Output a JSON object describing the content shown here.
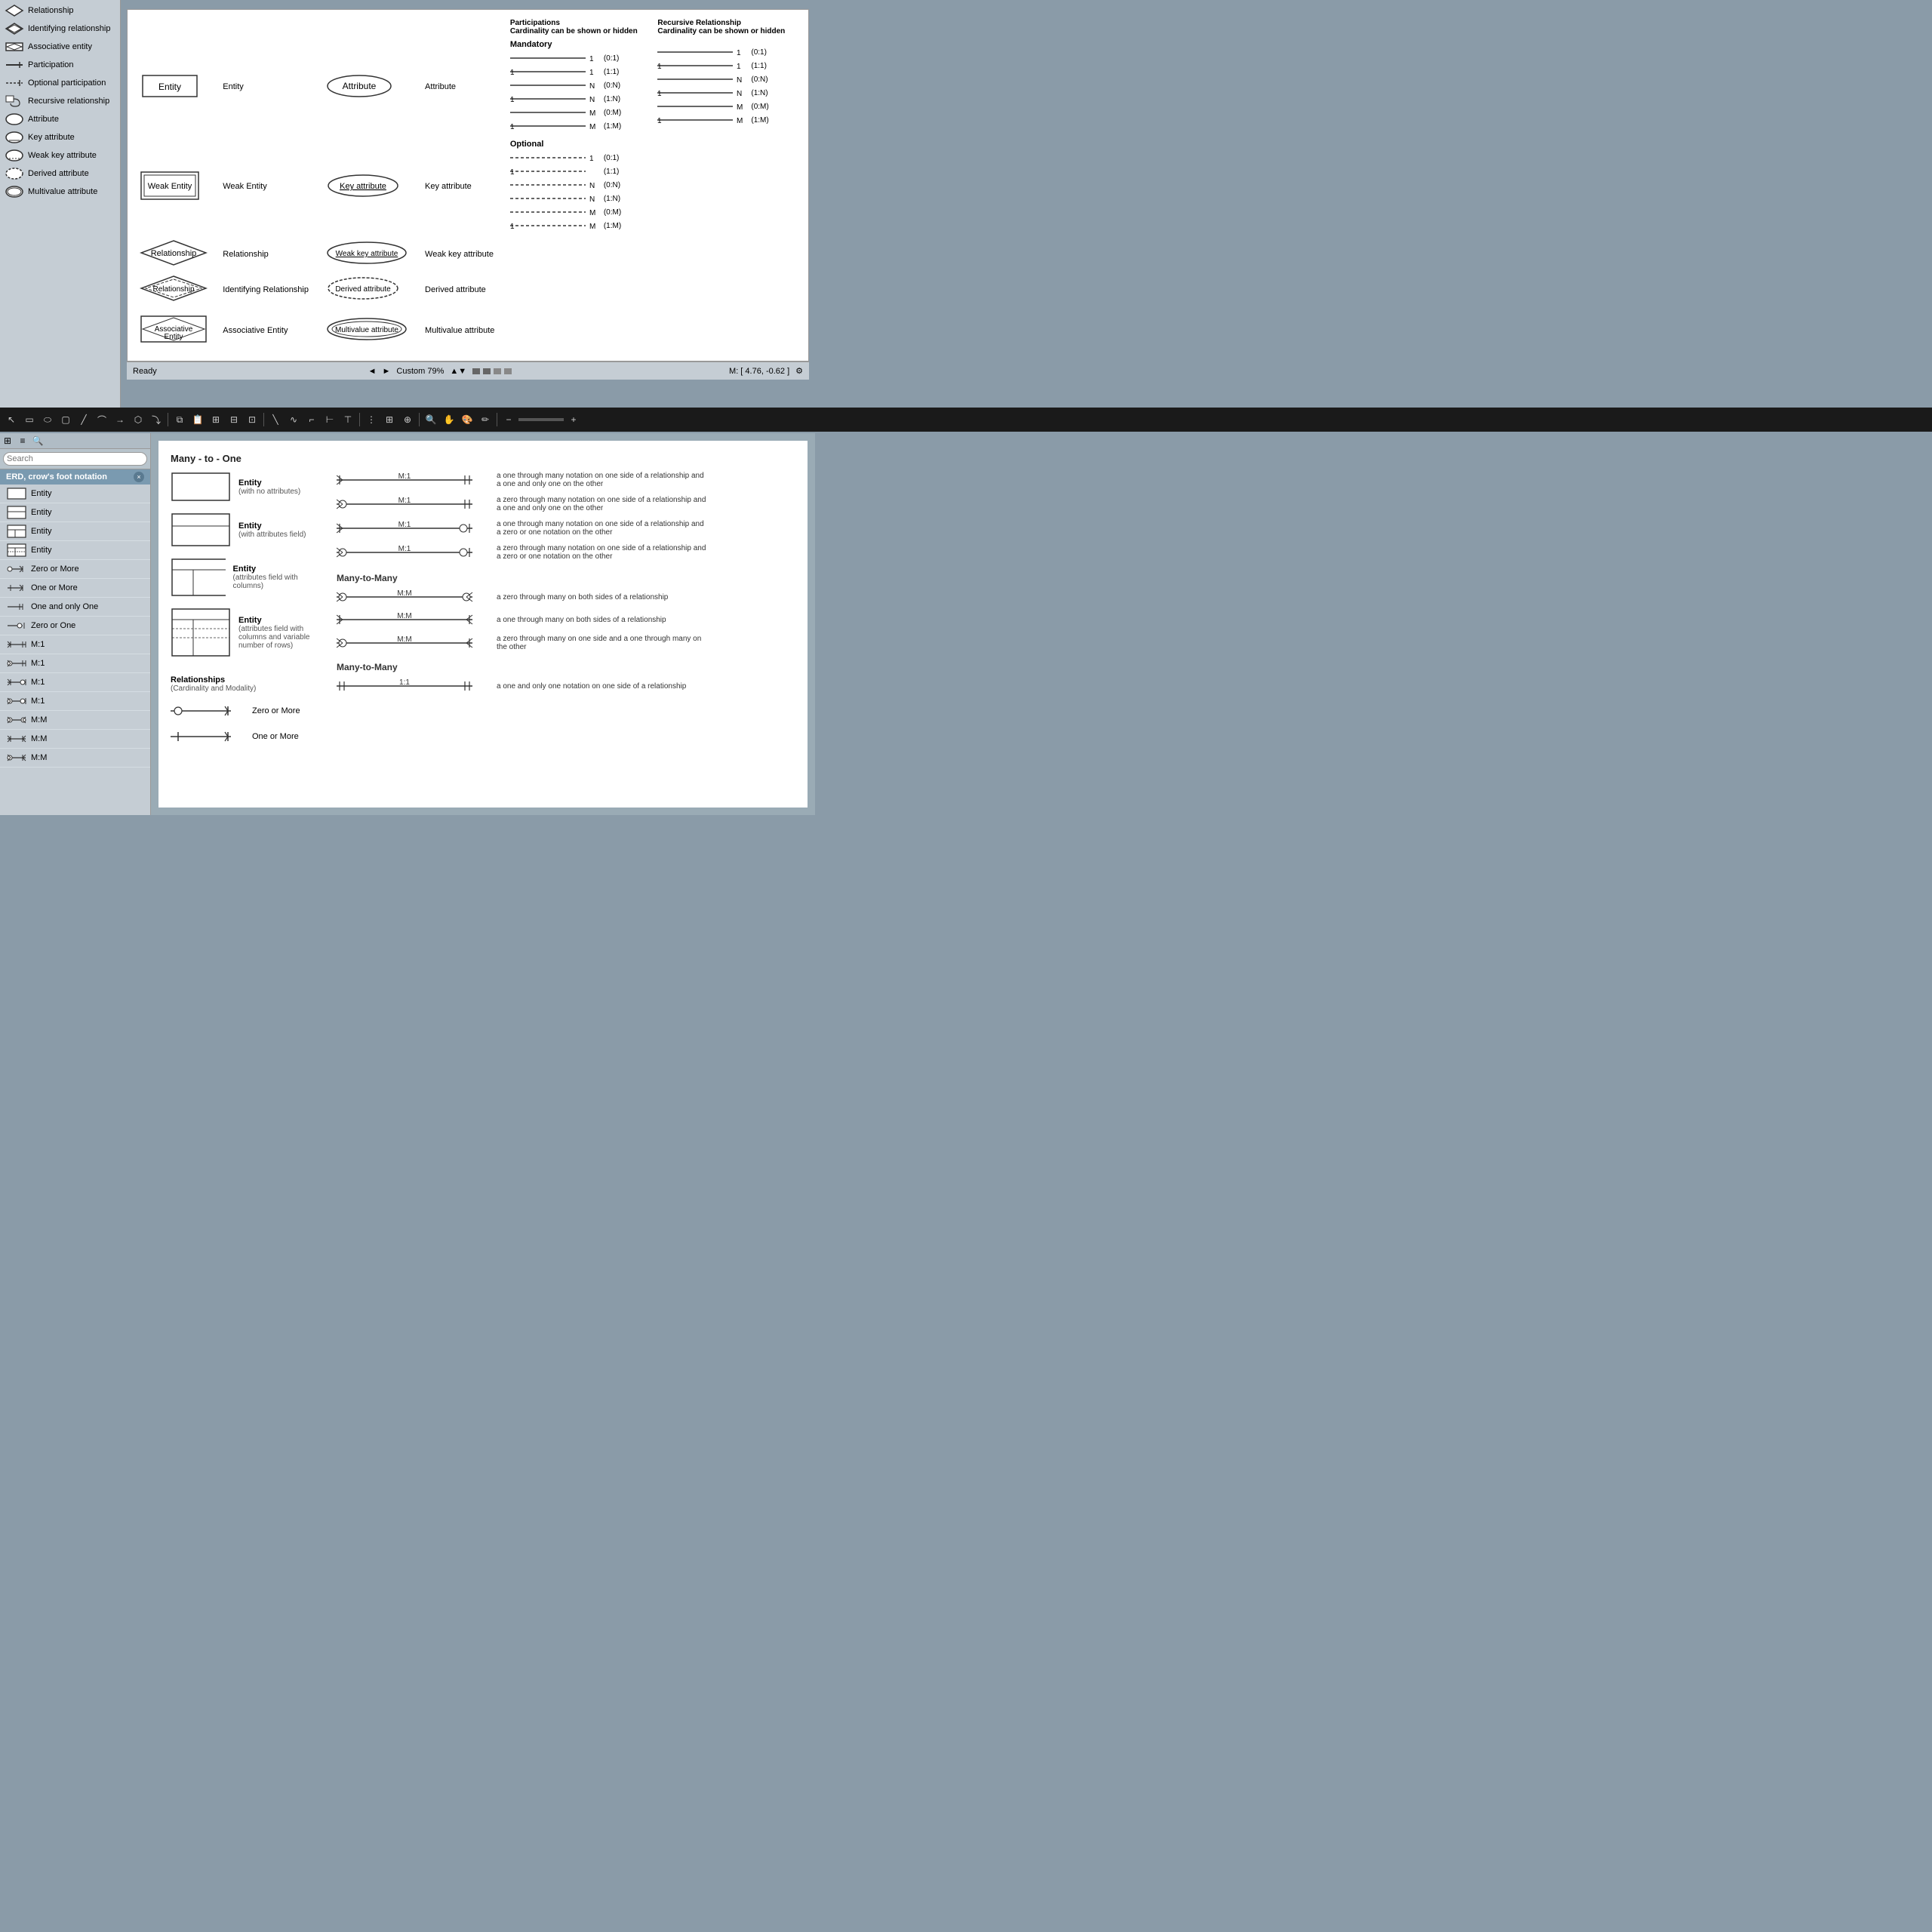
{
  "top": {
    "sidebar": {
      "items": [
        {
          "label": "Relationship",
          "icon": "relationship"
        },
        {
          "label": "Identifying relationship",
          "icon": "identifying-rel"
        },
        {
          "label": "Associative entity",
          "icon": "associative"
        },
        {
          "label": "Participation",
          "icon": "participation"
        },
        {
          "label": "Optional participation",
          "icon": "optional-part"
        },
        {
          "label": "Recursive relationship",
          "icon": "recursive-rel"
        },
        {
          "label": "Attribute",
          "icon": "attribute"
        },
        {
          "label": "Key attribute",
          "icon": "key-attr"
        },
        {
          "label": "Weak key attribute",
          "icon": "weak-key"
        },
        {
          "label": "Derived attribute",
          "icon": "derived-attr"
        },
        {
          "label": "Multivalue attribute",
          "icon": "multivalue-attr"
        }
      ]
    },
    "legend": {
      "columns": [
        "",
        "",
        "",
        "Attribute",
        "",
        "Participations\nCardinality can be shown or hidden",
        "",
        "Recursive Relationship\nCardinality can be shown or hidden"
      ],
      "rows": [
        {
          "shape1": "Entity",
          "label1": "Entity",
          "shape2": "Attribute",
          "label2": "Attribute",
          "mandatory_label": "Mandatory",
          "participations": [
            {
              "value1": "",
              "n1": "1",
              "notation": "(0:1)"
            },
            {
              "value1": "1",
              "n1": "1",
              "notation": "(1:1)"
            },
            {
              "value1": "",
              "n1": "N",
              "notation": "(0:N)"
            },
            {
              "value1": "1",
              "n1": "N",
              "notation": "(1:N)"
            },
            {
              "value1": "",
              "n1": "M",
              "notation": "(0:M)"
            },
            {
              "value1": "1",
              "n1": "M",
              "notation": "(1:M)"
            }
          ]
        }
      ],
      "entities": [
        {
          "shape": "entity",
          "label": "Entity",
          "attr_shape": "ellipse",
          "attr_label": "Attribute"
        },
        {
          "shape": "weak-entity",
          "label": "Weak Entity",
          "attr_shape": "ellipse-underline",
          "attr_label": "Key attribute"
        },
        {
          "shape": "diamond",
          "label": "Relationship",
          "attr_shape": "ellipse-dashed-underline",
          "attr_label": "Weak key attribute"
        },
        {
          "shape": "diamond-dashed",
          "label": "Identifying Relationship",
          "attr_shape": "ellipse-dashed",
          "attr_label": "Derived attribute"
        },
        {
          "shape": "assoc-entity",
          "label": "Associative Entity",
          "attr_shape": "ellipse-double",
          "attr_label": "Multivalue attribute"
        }
      ]
    },
    "status": {
      "ready": "Ready",
      "page": "Custom 79%",
      "coords": "M: [ 4.76, -0.62 ]"
    }
  },
  "bottom": {
    "toolbar": {
      "zoom_in": "+",
      "zoom_out": "-"
    },
    "sidebar": {
      "search_placeholder": "Search",
      "category": "ERD, crow's foot notation",
      "items": [
        {
          "label": "Entity"
        },
        {
          "label": "Entity"
        },
        {
          "label": "Entity"
        },
        {
          "label": "Entity"
        },
        {
          "label": "Zero or More"
        },
        {
          "label": "One or More"
        },
        {
          "label": "One and only One"
        },
        {
          "label": "Zero or One"
        },
        {
          "label": "M:1"
        },
        {
          "label": "M:1"
        },
        {
          "label": "M:1"
        },
        {
          "label": "M:1"
        },
        {
          "label": "M:M"
        },
        {
          "label": "M:M"
        },
        {
          "label": "M:M"
        }
      ]
    },
    "canvas": {
      "title": "Many - to - One",
      "entities": [
        {
          "label": "Entity",
          "desc": "(with no attributes)"
        },
        {
          "label": "Entity",
          "desc": "(with attributes field)"
        },
        {
          "label": "Entity",
          "desc": "(attributes field with columns)"
        },
        {
          "label": "Entity",
          "desc": "(attributes field with columns and\nvariable number of rows)"
        }
      ],
      "rel_section": "Relationships\n(Cardinality and Modality)",
      "many_to_one_rows": [
        {
          "notation": "M:1",
          "desc": "a one through many notation on one side of a relationship\nand a one and only one on the other"
        },
        {
          "notation": "M:1",
          "desc": "a zero through many notation on one side of a relationship\nand a one and only one on the other"
        },
        {
          "notation": "M:1",
          "desc": "a one through many notation on one side of a relationship\nand a zero or one notation on the other"
        },
        {
          "notation": "M:1",
          "desc": "a zero through many notation on one side of a relationship\nand a zero or one notation on the other"
        }
      ],
      "many_to_many_title": "Many-to-Many",
      "many_to_many_rows": [
        {
          "notation": "M:M",
          "desc": "a zero through many on both sides of a relationship"
        },
        {
          "notation": "M:M",
          "desc": "a one through many on both sides of a relationship"
        },
        {
          "notation": "M:M",
          "desc": "a zero through many on one side and a one through many\non the other"
        }
      ],
      "many_to_many_title2": "Many-to-Many",
      "zero_or_more": "Zero or More",
      "one_or_more": "One or More",
      "one_to_one": "1:1",
      "one_to_one_desc": "a one and only one notation on one side of a relationship"
    }
  }
}
